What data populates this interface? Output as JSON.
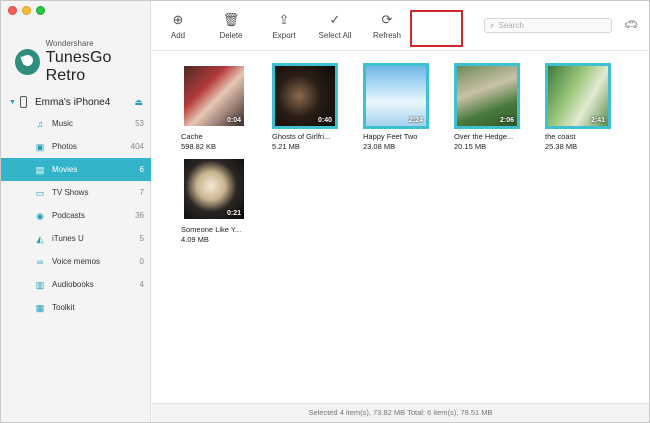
{
  "brand": {
    "small": "Wondershare",
    "big": "TunesGo Retro"
  },
  "device": {
    "name": "Emma's iPhone4"
  },
  "nav": [
    {
      "label": "Music",
      "count": "53",
      "icon": "music-note-icon",
      "glyph": "♫",
      "active": false
    },
    {
      "label": "Photos",
      "count": "404",
      "icon": "photo-icon",
      "glyph": "▣",
      "active": false
    },
    {
      "label": "Movies",
      "count": "6",
      "icon": "film-icon",
      "glyph": "▤",
      "active": true
    },
    {
      "label": "TV Shows",
      "count": "7",
      "icon": "tv-icon",
      "glyph": "▭",
      "active": false
    },
    {
      "label": "Podcasts",
      "count": "36",
      "icon": "podcast-icon",
      "glyph": "◉",
      "active": false
    },
    {
      "label": "iTunes U",
      "count": "5",
      "icon": "graduation-cap-icon",
      "glyph": "◭",
      "active": false
    },
    {
      "label": "Voice memos",
      "count": "0",
      "icon": "voice-memo-icon",
      "glyph": "∞",
      "active": false
    },
    {
      "label": "Audiobooks",
      "count": "4",
      "icon": "book-icon",
      "glyph": "▥",
      "active": false
    },
    {
      "label": "Toolkit",
      "count": "",
      "icon": "toolkit-icon",
      "glyph": "▦",
      "active": false
    }
  ],
  "toolbar": {
    "add": "Add",
    "delete": "Delete",
    "export": "Export",
    "select_all": "Select All",
    "refresh": "Refresh",
    "search_placeholder": "Search"
  },
  "movies": [
    {
      "name": "Cache",
      "size": "598.82 KB",
      "duration": "0:04",
      "selected": false,
      "img": "img-cache"
    },
    {
      "name": "Ghosts of Girlfri...",
      "size": "5.21 MB",
      "duration": "0:40",
      "selected": true,
      "img": "img-ghosts"
    },
    {
      "name": "Happy Feet Two",
      "size": "23.08 MB",
      "duration": "2:24",
      "selected": true,
      "img": "img-happy"
    },
    {
      "name": "Over the Hedge...",
      "size": "20.15 MB",
      "duration": "2:06",
      "selected": true,
      "img": "img-hedge"
    },
    {
      "name": "the coast",
      "size": "25.38 MB",
      "duration": "2:41",
      "selected": true,
      "img": "img-coast"
    },
    {
      "name": "Someone Like Y...",
      "size": "4.09 MB",
      "duration": "0:21",
      "selected": false,
      "img": "img-someone"
    }
  ],
  "status": {
    "text": "Selected 4 item(s), 73.82 MB    Total: 6 item(s), 78.51 MB"
  },
  "colors": {
    "accent": "#34b4c8",
    "selection_border": "#3fc0d0",
    "export_highlight": "#d0282d"
  }
}
